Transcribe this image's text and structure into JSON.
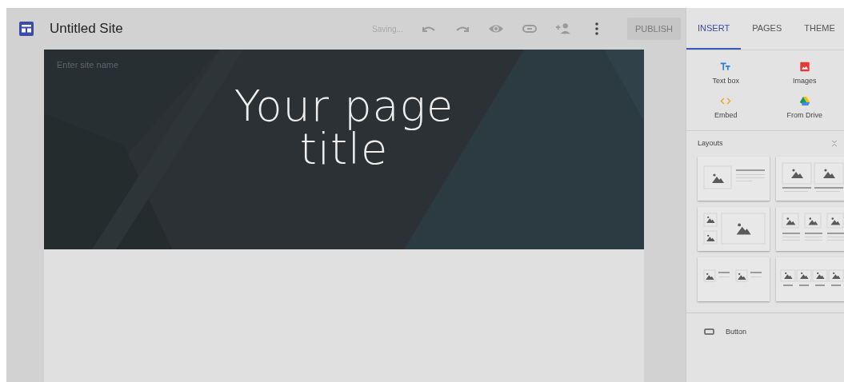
{
  "app_bar": {
    "title": "Untitled Site",
    "status": "Saving...",
    "actions": [
      {
        "kind": "undo"
      },
      {
        "kind": "redo"
      },
      {
        "kind": "preview"
      },
      {
        "kind": "link"
      },
      {
        "kind": "share"
      },
      {
        "kind": "more"
      }
    ],
    "publish": {
      "label": "PUBLISH",
      "disabled": true
    }
  },
  "page": {
    "site_name": {
      "placeholder": "Enter site name"
    },
    "title": "Your page\ntitle"
  },
  "panel": {
    "tabs": [
      {
        "label": "INSERT",
        "selected": true
      },
      {
        "label": "PAGES",
        "selected": false
      },
      {
        "label": "THEME",
        "selected": false
      }
    ],
    "insert_items": [
      {
        "kind": "text",
        "label": "Text box"
      },
      {
        "kind": "image",
        "label": "Images"
      },
      {
        "kind": "embed",
        "label": "Embed"
      },
      {
        "kind": "drive",
        "label": "From Drive"
      }
    ],
    "layouts": {
      "title": "Layouts",
      "expanded": true,
      "items": [
        {
          "kind": "image-text"
        },
        {
          "kind": "two-images"
        },
        {
          "kind": "mosaic"
        },
        {
          "kind": "three-columns"
        },
        {
          "kind": "two-image-text"
        },
        {
          "kind": "four-images"
        }
      ]
    },
    "button_item": {
      "label": "Button"
    }
  }
}
